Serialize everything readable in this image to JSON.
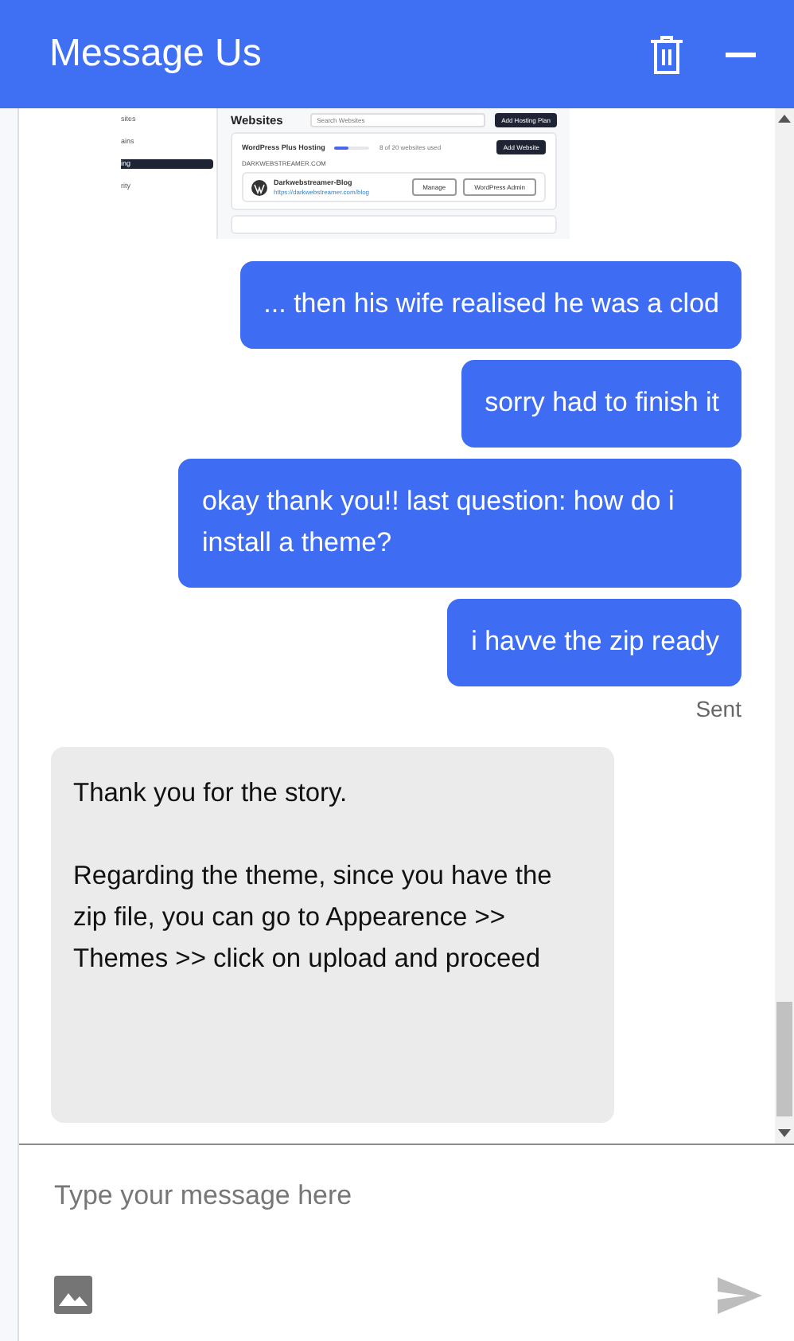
{
  "header": {
    "title": "Message Us"
  },
  "shared_screenshot": {
    "sidebar_items": [
      {
        "label": "sites",
        "selected": false
      },
      {
        "label": "ains",
        "selected": false
      },
      {
        "label": "ing",
        "selected": true
      },
      {
        "label": "rity",
        "selected": false
      }
    ],
    "page_title": "Websites",
    "search": {
      "placeholder": "Search Websites"
    },
    "add_plan_button": "Add Hosting Plan",
    "plan": {
      "name": "WordPress Plus Hosting",
      "level": 0.4,
      "usage": "8 of 20 websites used",
      "domain": "DARKWEBSTREAMER.COM",
      "add_button": "Add Website"
    },
    "site": {
      "name": "Darkwebstreamer-Blog",
      "url": "https://darkwebstreamer.com/blog",
      "buttons": [
        "Manage",
        "WordPress Admin"
      ]
    }
  },
  "messages": [
    {
      "kind": "user",
      "text": "... then his wife realised he was a clod"
    },
    {
      "kind": "user",
      "text": "sorry had to finish it"
    },
    {
      "kind": "user",
      "text": "okay thank you!! last question: how do i install a theme?"
    },
    {
      "kind": "user",
      "text": "i havve the zip ready",
      "status": "Sent"
    },
    {
      "kind": "agent",
      "text": "Thank you for the story.\n\nRegarding the theme, since you have the zip file, you can go to Appearence >> Themes >> click on upload and proceed"
    }
  ],
  "composer": {
    "placeholder": "Type your message here"
  }
}
